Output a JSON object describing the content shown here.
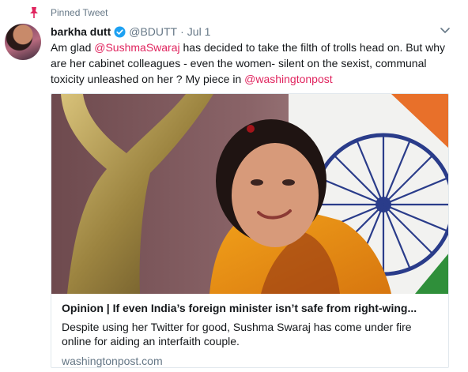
{
  "pinned": {
    "label": "Pinned Tweet",
    "icon": "pin-icon",
    "icon_color": "#e0245e"
  },
  "author": {
    "name": "barkha dutt",
    "handle": "@BDUTT",
    "separator": "·",
    "date": "Jul 1",
    "verified_icon": "verified-badge-icon",
    "verified_color": "#1da1f2"
  },
  "menu": {
    "icon": "chevron-down-icon"
  },
  "tweet": {
    "text_1": "Am glad ",
    "mention_1": "@SushmaSwaraj",
    "text_2": " has decided to take the filth of trolls head on. But why are her cabinet colleagues - even the women- silent on the sexist, communal toxicity unleashed on her ? My piece in ",
    "mention_2": "@washingtonpost",
    "mention_color": "#e0245e"
  },
  "card": {
    "title": "Opinion | If even India’s foreign minister isn’t safe from right-wing...",
    "description": "Despite using her Twitter for good, Sushma Swaraj has come under fire online for aiding an interfaith couple.",
    "domain": "washingtonpost.com"
  }
}
